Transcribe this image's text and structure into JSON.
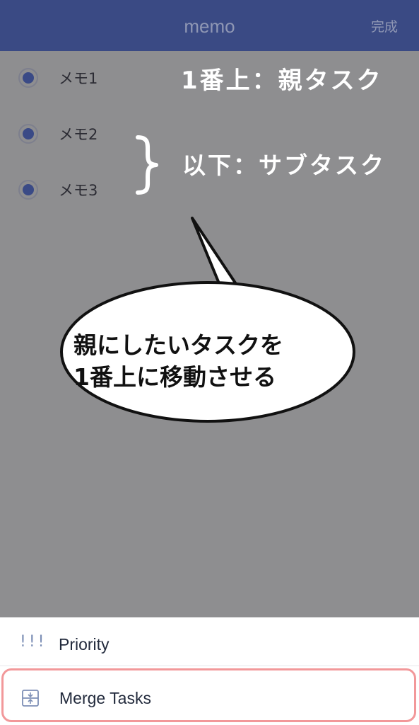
{
  "nav": {
    "title": "memo",
    "done_label": "完成"
  },
  "tasks": [
    {
      "label": "メモ1"
    },
    {
      "label": "メモ2"
    },
    {
      "label": "メモ3"
    }
  ],
  "annotations": {
    "parent_note": "1番上：親タスク",
    "sub_note": "以下：サブタスク",
    "bubble_line_1": "親にしたいタスクを",
    "bubble_line_2": "1番上に移動させる"
  },
  "sheet": {
    "priority_label": "Priority",
    "priority_icon": "!!!",
    "merge_label": "Merge Tasks",
    "merge_icon": "merge-icon"
  },
  "colors": {
    "nav_background": "#3a4a84",
    "overlay_gray": "#8e8e90",
    "radio_fill": "#3a4a86",
    "highlight_border": "#f2989a"
  }
}
